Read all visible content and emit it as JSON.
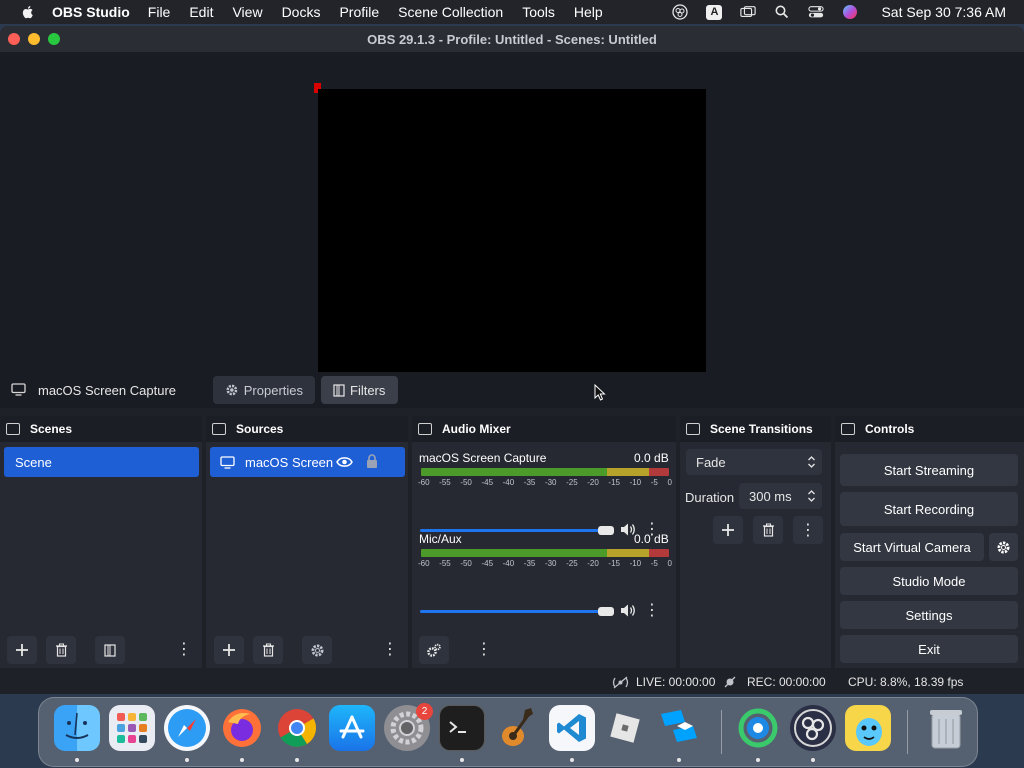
{
  "menubar": {
    "app_name": "OBS Studio",
    "items": [
      "File",
      "Edit",
      "View",
      "Docks",
      "Profile",
      "Scene Collection",
      "Tools",
      "Help"
    ],
    "input_indicator": "A",
    "clock": "Sat Sep 30  7:36 AM"
  },
  "window": {
    "title": "OBS 29.1.3 - Profile: Untitled - Scenes: Untitled"
  },
  "source_bar": {
    "selected_source": "macOS Screen Capture",
    "properties_label": "Properties",
    "filters_label": "Filters"
  },
  "scenes": {
    "header": "Scenes",
    "items": [
      "Scene"
    ]
  },
  "sources": {
    "header": "Sources",
    "items": [
      "macOS Screen"
    ]
  },
  "audio_mixer": {
    "header": "Audio Mixer",
    "channels": [
      {
        "name": "macOS Screen Capture",
        "level": "0.0 dB",
        "volume": 1.0
      },
      {
        "name": "Mic/Aux",
        "level": "0.0 dB",
        "volume": 1.0
      }
    ],
    "scale": [
      "-60",
      "-55",
      "-50",
      "-45",
      "-40",
      "-35",
      "-30",
      "-25",
      "-20",
      "-15",
      "-10",
      "-5",
      "0"
    ]
  },
  "transitions": {
    "header": "Scene Transitions",
    "selected": "Fade",
    "duration_label": "Duration",
    "duration_value": "300 ms"
  },
  "controls": {
    "header": "Controls",
    "start_streaming": "Start Streaming",
    "start_recording": "Start Recording",
    "start_virtual_camera": "Start Virtual Camera",
    "studio_mode": "Studio Mode",
    "settings": "Settings",
    "exit": "Exit"
  },
  "status": {
    "live": "LIVE: 00:00:00",
    "rec": "REC: 00:00:00",
    "cpu": "CPU: 8.8%, 18.39 fps"
  },
  "dock": {
    "settings_badge": "2"
  },
  "colors": {
    "accent": "#1f5fd6",
    "preview_marker": "#d90000",
    "meter_green": "#4c9a2a",
    "meter_yellow": "#b8a32a",
    "meter_red": "#b23a3a"
  }
}
